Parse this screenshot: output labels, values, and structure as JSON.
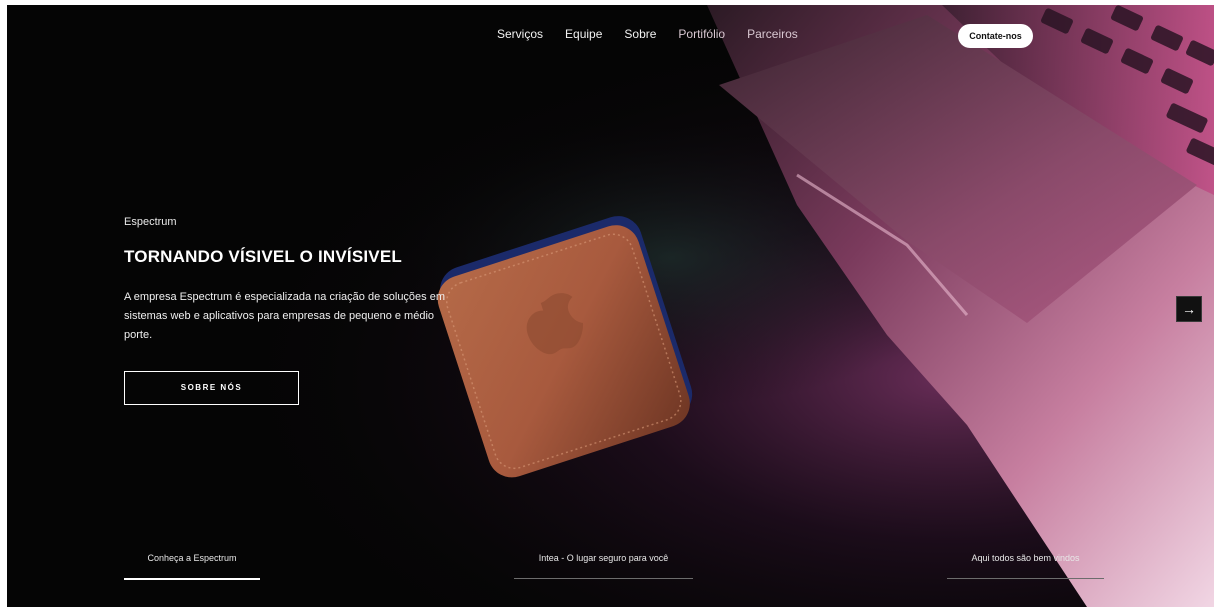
{
  "nav": {
    "items": [
      "Serviços",
      "Equipe",
      "Sobre",
      "Portifólio",
      "Parceiros"
    ],
    "contact_label": "Contate-nos"
  },
  "hero": {
    "brand": "Espectrum",
    "title": "TORNANDO VÍSIVEL O INVÍSIVEL",
    "description": "A empresa Espectrum é especializada na criação de soluções em sistemas web e aplicativos para empresas de pequeno e médio porte.",
    "button_label": "SOBRE NÓS"
  },
  "slider": {
    "next_icon": "→",
    "tabs": [
      {
        "label": "Conheça a Espectrum",
        "active": true
      },
      {
        "label": "Intea - O lugar seguro para você",
        "active": false
      },
      {
        "label": "Aqui todos são bem vindos",
        "active": false
      }
    ]
  },
  "colors": {
    "background": "#050505",
    "text": "#ffffff",
    "accent_pink": "#c9487c"
  }
}
